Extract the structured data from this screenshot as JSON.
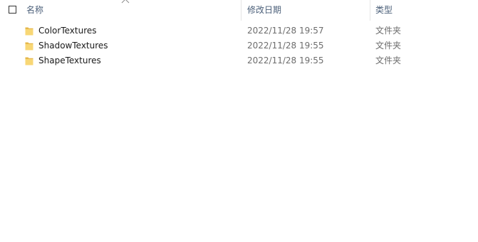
{
  "columns": {
    "name": "名称",
    "date_modified": "修改日期",
    "type": "类型"
  },
  "sort": {
    "column": "name",
    "icon": "chevron-up-icon"
  },
  "files": [
    {
      "name": "ColorTextures",
      "date_modified": "2022/11/28 19:57",
      "type": "文件夹",
      "icon": "folder-icon"
    },
    {
      "name": "ShadowTextures",
      "date_modified": "2022/11/28 19:55",
      "type": "文件夹",
      "icon": "folder-icon"
    },
    {
      "name": "ShapeTextures",
      "date_modified": "2022/11/28 19:55",
      "type": "文件夹",
      "icon": "folder-icon"
    }
  ],
  "colors": {
    "header_text": "#4c607a",
    "folder_yellow": "#f8d775",
    "folder_dark": "#e6b84b",
    "secondary_text": "#6d6d6d"
  }
}
